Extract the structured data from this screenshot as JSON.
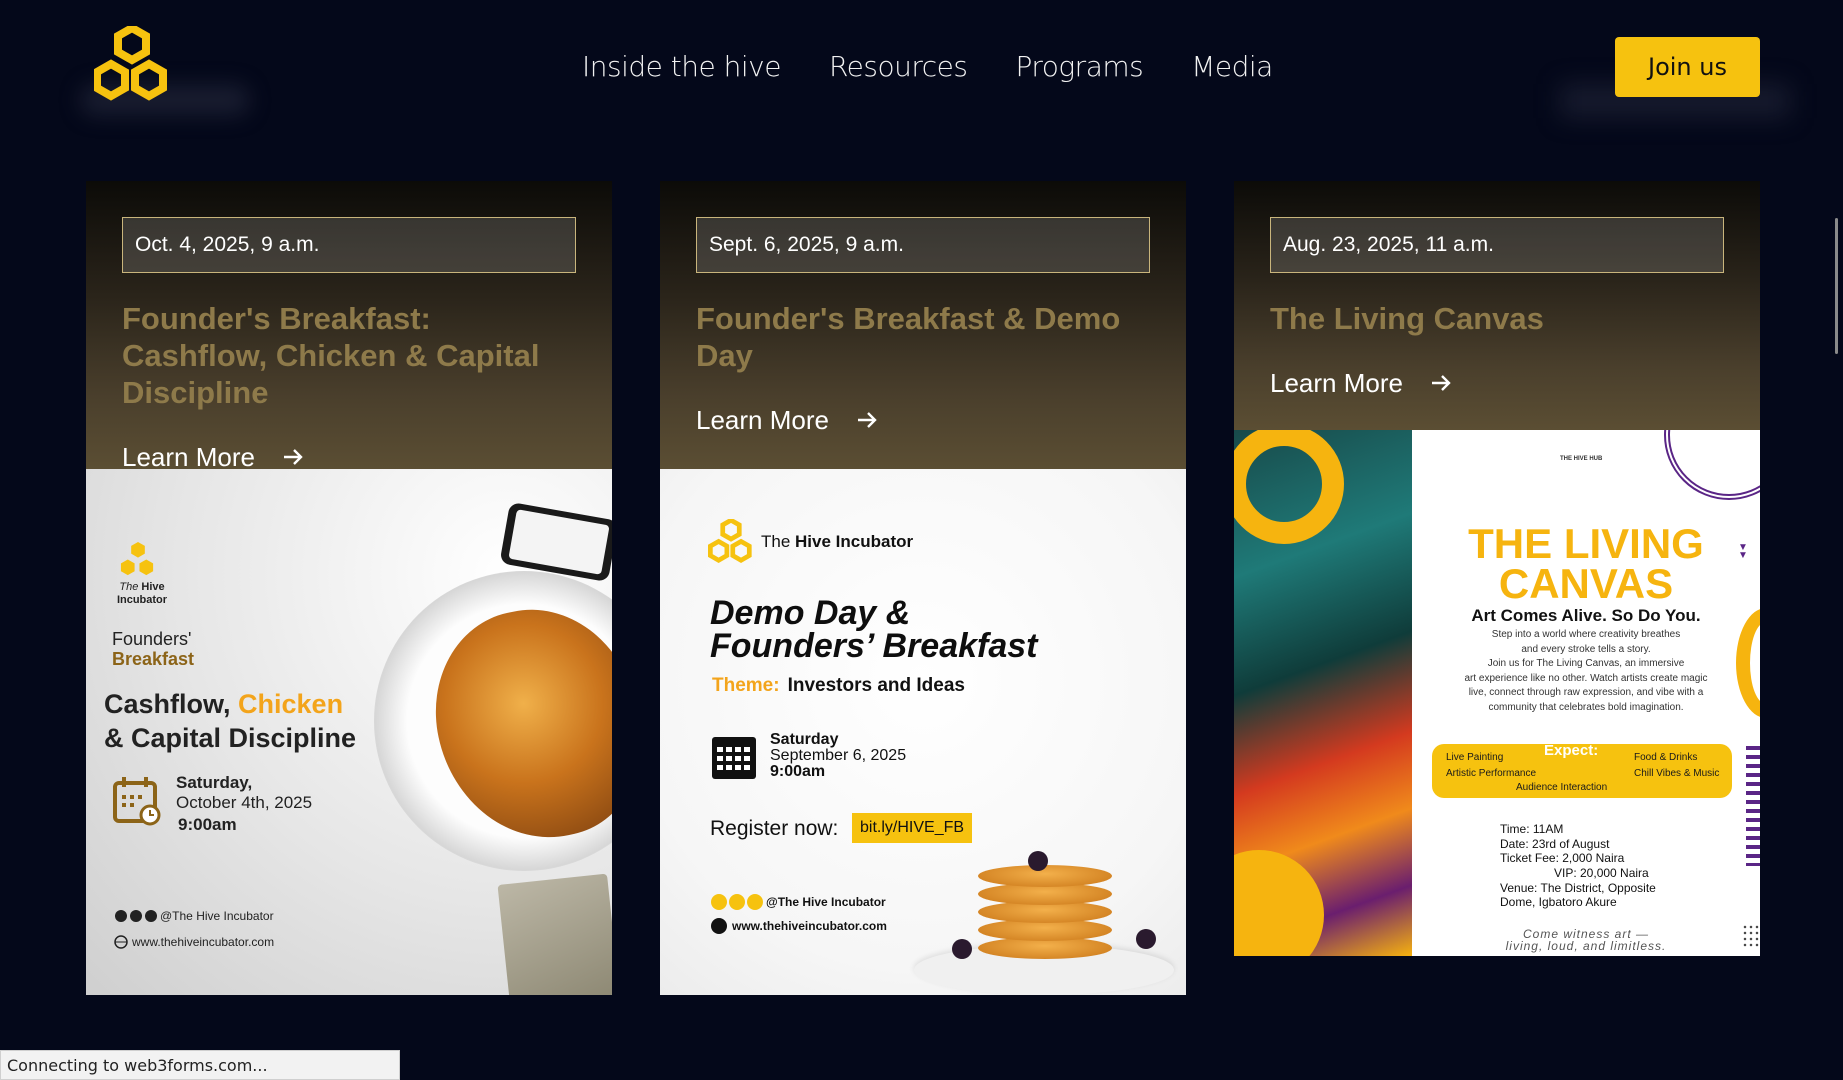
{
  "nav": {
    "items": [
      "Inside the hive",
      "Resources",
      "Programs",
      "Media"
    ],
    "join_label": "Join us"
  },
  "events": [
    {
      "date": "Oct. 4, 2025, 9 a.m.",
      "title": "Founder's Breakfast: Cashflow, Chicken & Capital Discipline",
      "learn_more": "Learn More",
      "poster": {
        "brand_italic": "The",
        "brand": "Hive Incubator",
        "label_1": "Founders'",
        "label_2": "Breakfast",
        "headline_a": "Cashflow,",
        "headline_highlight": "Chicken",
        "headline_b": "& Capital Discipline",
        "day": "Saturday,",
        "date": "October 4th, 2025",
        "time": "9:00am",
        "social": "@The Hive Incubator",
        "website": "www.thehiveincubator.com"
      }
    },
    {
      "date": "Sept. 6, 2025, 9 a.m.",
      "title": "Founder's Breakfast & Demo Day",
      "learn_more": "Learn More",
      "poster": {
        "brand_pre": "The",
        "brand": "Hive Incubator",
        "headline_1": "Demo Day &",
        "headline_2": "Founders’ Breakfast",
        "theme_label": "Theme:",
        "theme": "Investors and Ideas",
        "day": "Saturday",
        "date": "September 6, 2025",
        "time": "9:00am",
        "register_label": "Register now:",
        "register_link": "bit.ly/HIVE_FB",
        "social": "@The Hive Incubator",
        "website": "www.thehiveincubator.com"
      }
    },
    {
      "date": "Aug. 23, 2025, 11 a.m.",
      "title": "The Living Canvas",
      "learn_more": "Learn More",
      "poster": {
        "hub": "THE HIVE HUB",
        "title_1": "THE LIVING",
        "title_2": "CANVAS",
        "subtitle": "Art Comes Alive. So Do You.",
        "desc_1": "Step into a world where creativity breathes",
        "desc_2": "and every stroke tells a story.",
        "desc_3": "Join us for The Living Canvas, an immersive",
        "desc_4": "art experience like no other. Watch artists create magic",
        "desc_5": "live, connect through raw expression, and vibe with a",
        "desc_6": "community that celebrates bold imagination.",
        "expect": "Expect:",
        "expect_items": [
          "Live Painting",
          "Food & Drinks",
          "Artistic Performance",
          "Chill Vibes & Music",
          "Audience Interaction"
        ],
        "time": "Time: 11AM",
        "date": "Date: 23rd of August",
        "fee": "Ticket Fee: 2,000 Naira",
        "vip": "VIP: 20,000 Naira",
        "venue_1": "Venue: The District, Opposite",
        "venue_2": "Dome, Igbatoro Akure",
        "tagline_1": "Come witness art —",
        "tagline_2": "living, loud, and limitless."
      }
    }
  ],
  "status_bar": "Connecting to web3forms.com...",
  "colors": {
    "background": "#04081a",
    "accent": "#f6c20f",
    "title": "#8e7a4a"
  },
  "icons": [
    "hive-logo-icon",
    "arrow-right-icon",
    "calendar-icon",
    "facebook-icon",
    "linkedin-icon",
    "instagram-icon",
    "globe-icon"
  ]
}
